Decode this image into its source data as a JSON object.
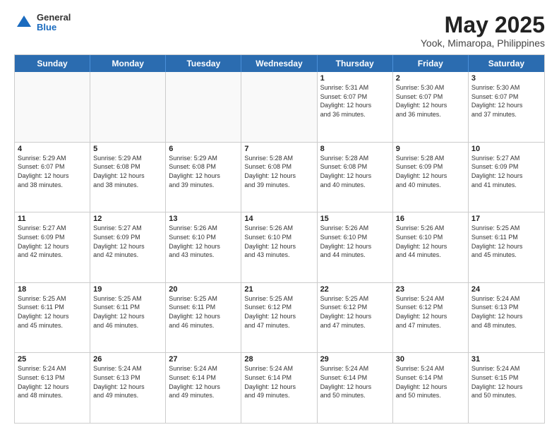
{
  "logo": {
    "general": "General",
    "blue": "Blue"
  },
  "title": {
    "month": "May 2025",
    "location": "Yook, Mimaropa, Philippines"
  },
  "header_days": [
    "Sunday",
    "Monday",
    "Tuesday",
    "Wednesday",
    "Thursday",
    "Friday",
    "Saturday"
  ],
  "weeks": [
    [
      {
        "day": "",
        "info": "",
        "empty": true
      },
      {
        "day": "",
        "info": "",
        "empty": true
      },
      {
        "day": "",
        "info": "",
        "empty": true
      },
      {
        "day": "",
        "info": "",
        "empty": true
      },
      {
        "day": "1",
        "info": "Sunrise: 5:31 AM\nSunset: 6:07 PM\nDaylight: 12 hours\nand 36 minutes.",
        "empty": false
      },
      {
        "day": "2",
        "info": "Sunrise: 5:30 AM\nSunset: 6:07 PM\nDaylight: 12 hours\nand 36 minutes.",
        "empty": false
      },
      {
        "day": "3",
        "info": "Sunrise: 5:30 AM\nSunset: 6:07 PM\nDaylight: 12 hours\nand 37 minutes.",
        "empty": false
      }
    ],
    [
      {
        "day": "4",
        "info": "Sunrise: 5:29 AM\nSunset: 6:07 PM\nDaylight: 12 hours\nand 38 minutes.",
        "empty": false
      },
      {
        "day": "5",
        "info": "Sunrise: 5:29 AM\nSunset: 6:08 PM\nDaylight: 12 hours\nand 38 minutes.",
        "empty": false
      },
      {
        "day": "6",
        "info": "Sunrise: 5:29 AM\nSunset: 6:08 PM\nDaylight: 12 hours\nand 39 minutes.",
        "empty": false
      },
      {
        "day": "7",
        "info": "Sunrise: 5:28 AM\nSunset: 6:08 PM\nDaylight: 12 hours\nand 39 minutes.",
        "empty": false
      },
      {
        "day": "8",
        "info": "Sunrise: 5:28 AM\nSunset: 6:08 PM\nDaylight: 12 hours\nand 40 minutes.",
        "empty": false
      },
      {
        "day": "9",
        "info": "Sunrise: 5:28 AM\nSunset: 6:09 PM\nDaylight: 12 hours\nand 40 minutes.",
        "empty": false
      },
      {
        "day": "10",
        "info": "Sunrise: 5:27 AM\nSunset: 6:09 PM\nDaylight: 12 hours\nand 41 minutes.",
        "empty": false
      }
    ],
    [
      {
        "day": "11",
        "info": "Sunrise: 5:27 AM\nSunset: 6:09 PM\nDaylight: 12 hours\nand 42 minutes.",
        "empty": false
      },
      {
        "day": "12",
        "info": "Sunrise: 5:27 AM\nSunset: 6:09 PM\nDaylight: 12 hours\nand 42 minutes.",
        "empty": false
      },
      {
        "day": "13",
        "info": "Sunrise: 5:26 AM\nSunset: 6:10 PM\nDaylight: 12 hours\nand 43 minutes.",
        "empty": false
      },
      {
        "day": "14",
        "info": "Sunrise: 5:26 AM\nSunset: 6:10 PM\nDaylight: 12 hours\nand 43 minutes.",
        "empty": false
      },
      {
        "day": "15",
        "info": "Sunrise: 5:26 AM\nSunset: 6:10 PM\nDaylight: 12 hours\nand 44 minutes.",
        "empty": false
      },
      {
        "day": "16",
        "info": "Sunrise: 5:26 AM\nSunset: 6:10 PM\nDaylight: 12 hours\nand 44 minutes.",
        "empty": false
      },
      {
        "day": "17",
        "info": "Sunrise: 5:25 AM\nSunset: 6:11 PM\nDaylight: 12 hours\nand 45 minutes.",
        "empty": false
      }
    ],
    [
      {
        "day": "18",
        "info": "Sunrise: 5:25 AM\nSunset: 6:11 PM\nDaylight: 12 hours\nand 45 minutes.",
        "empty": false
      },
      {
        "day": "19",
        "info": "Sunrise: 5:25 AM\nSunset: 6:11 PM\nDaylight: 12 hours\nand 46 minutes.",
        "empty": false
      },
      {
        "day": "20",
        "info": "Sunrise: 5:25 AM\nSunset: 6:11 PM\nDaylight: 12 hours\nand 46 minutes.",
        "empty": false
      },
      {
        "day": "21",
        "info": "Sunrise: 5:25 AM\nSunset: 6:12 PM\nDaylight: 12 hours\nand 47 minutes.",
        "empty": false
      },
      {
        "day": "22",
        "info": "Sunrise: 5:25 AM\nSunset: 6:12 PM\nDaylight: 12 hours\nand 47 minutes.",
        "empty": false
      },
      {
        "day": "23",
        "info": "Sunrise: 5:24 AM\nSunset: 6:12 PM\nDaylight: 12 hours\nand 47 minutes.",
        "empty": false
      },
      {
        "day": "24",
        "info": "Sunrise: 5:24 AM\nSunset: 6:13 PM\nDaylight: 12 hours\nand 48 minutes.",
        "empty": false
      }
    ],
    [
      {
        "day": "25",
        "info": "Sunrise: 5:24 AM\nSunset: 6:13 PM\nDaylight: 12 hours\nand 48 minutes.",
        "empty": false
      },
      {
        "day": "26",
        "info": "Sunrise: 5:24 AM\nSunset: 6:13 PM\nDaylight: 12 hours\nand 49 minutes.",
        "empty": false
      },
      {
        "day": "27",
        "info": "Sunrise: 5:24 AM\nSunset: 6:14 PM\nDaylight: 12 hours\nand 49 minutes.",
        "empty": false
      },
      {
        "day": "28",
        "info": "Sunrise: 5:24 AM\nSunset: 6:14 PM\nDaylight: 12 hours\nand 49 minutes.",
        "empty": false
      },
      {
        "day": "29",
        "info": "Sunrise: 5:24 AM\nSunset: 6:14 PM\nDaylight: 12 hours\nand 50 minutes.",
        "empty": false
      },
      {
        "day": "30",
        "info": "Sunrise: 5:24 AM\nSunset: 6:14 PM\nDaylight: 12 hours\nand 50 minutes.",
        "empty": false
      },
      {
        "day": "31",
        "info": "Sunrise: 5:24 AM\nSunset: 6:15 PM\nDaylight: 12 hours\nand 50 minutes.",
        "empty": false
      }
    ]
  ]
}
